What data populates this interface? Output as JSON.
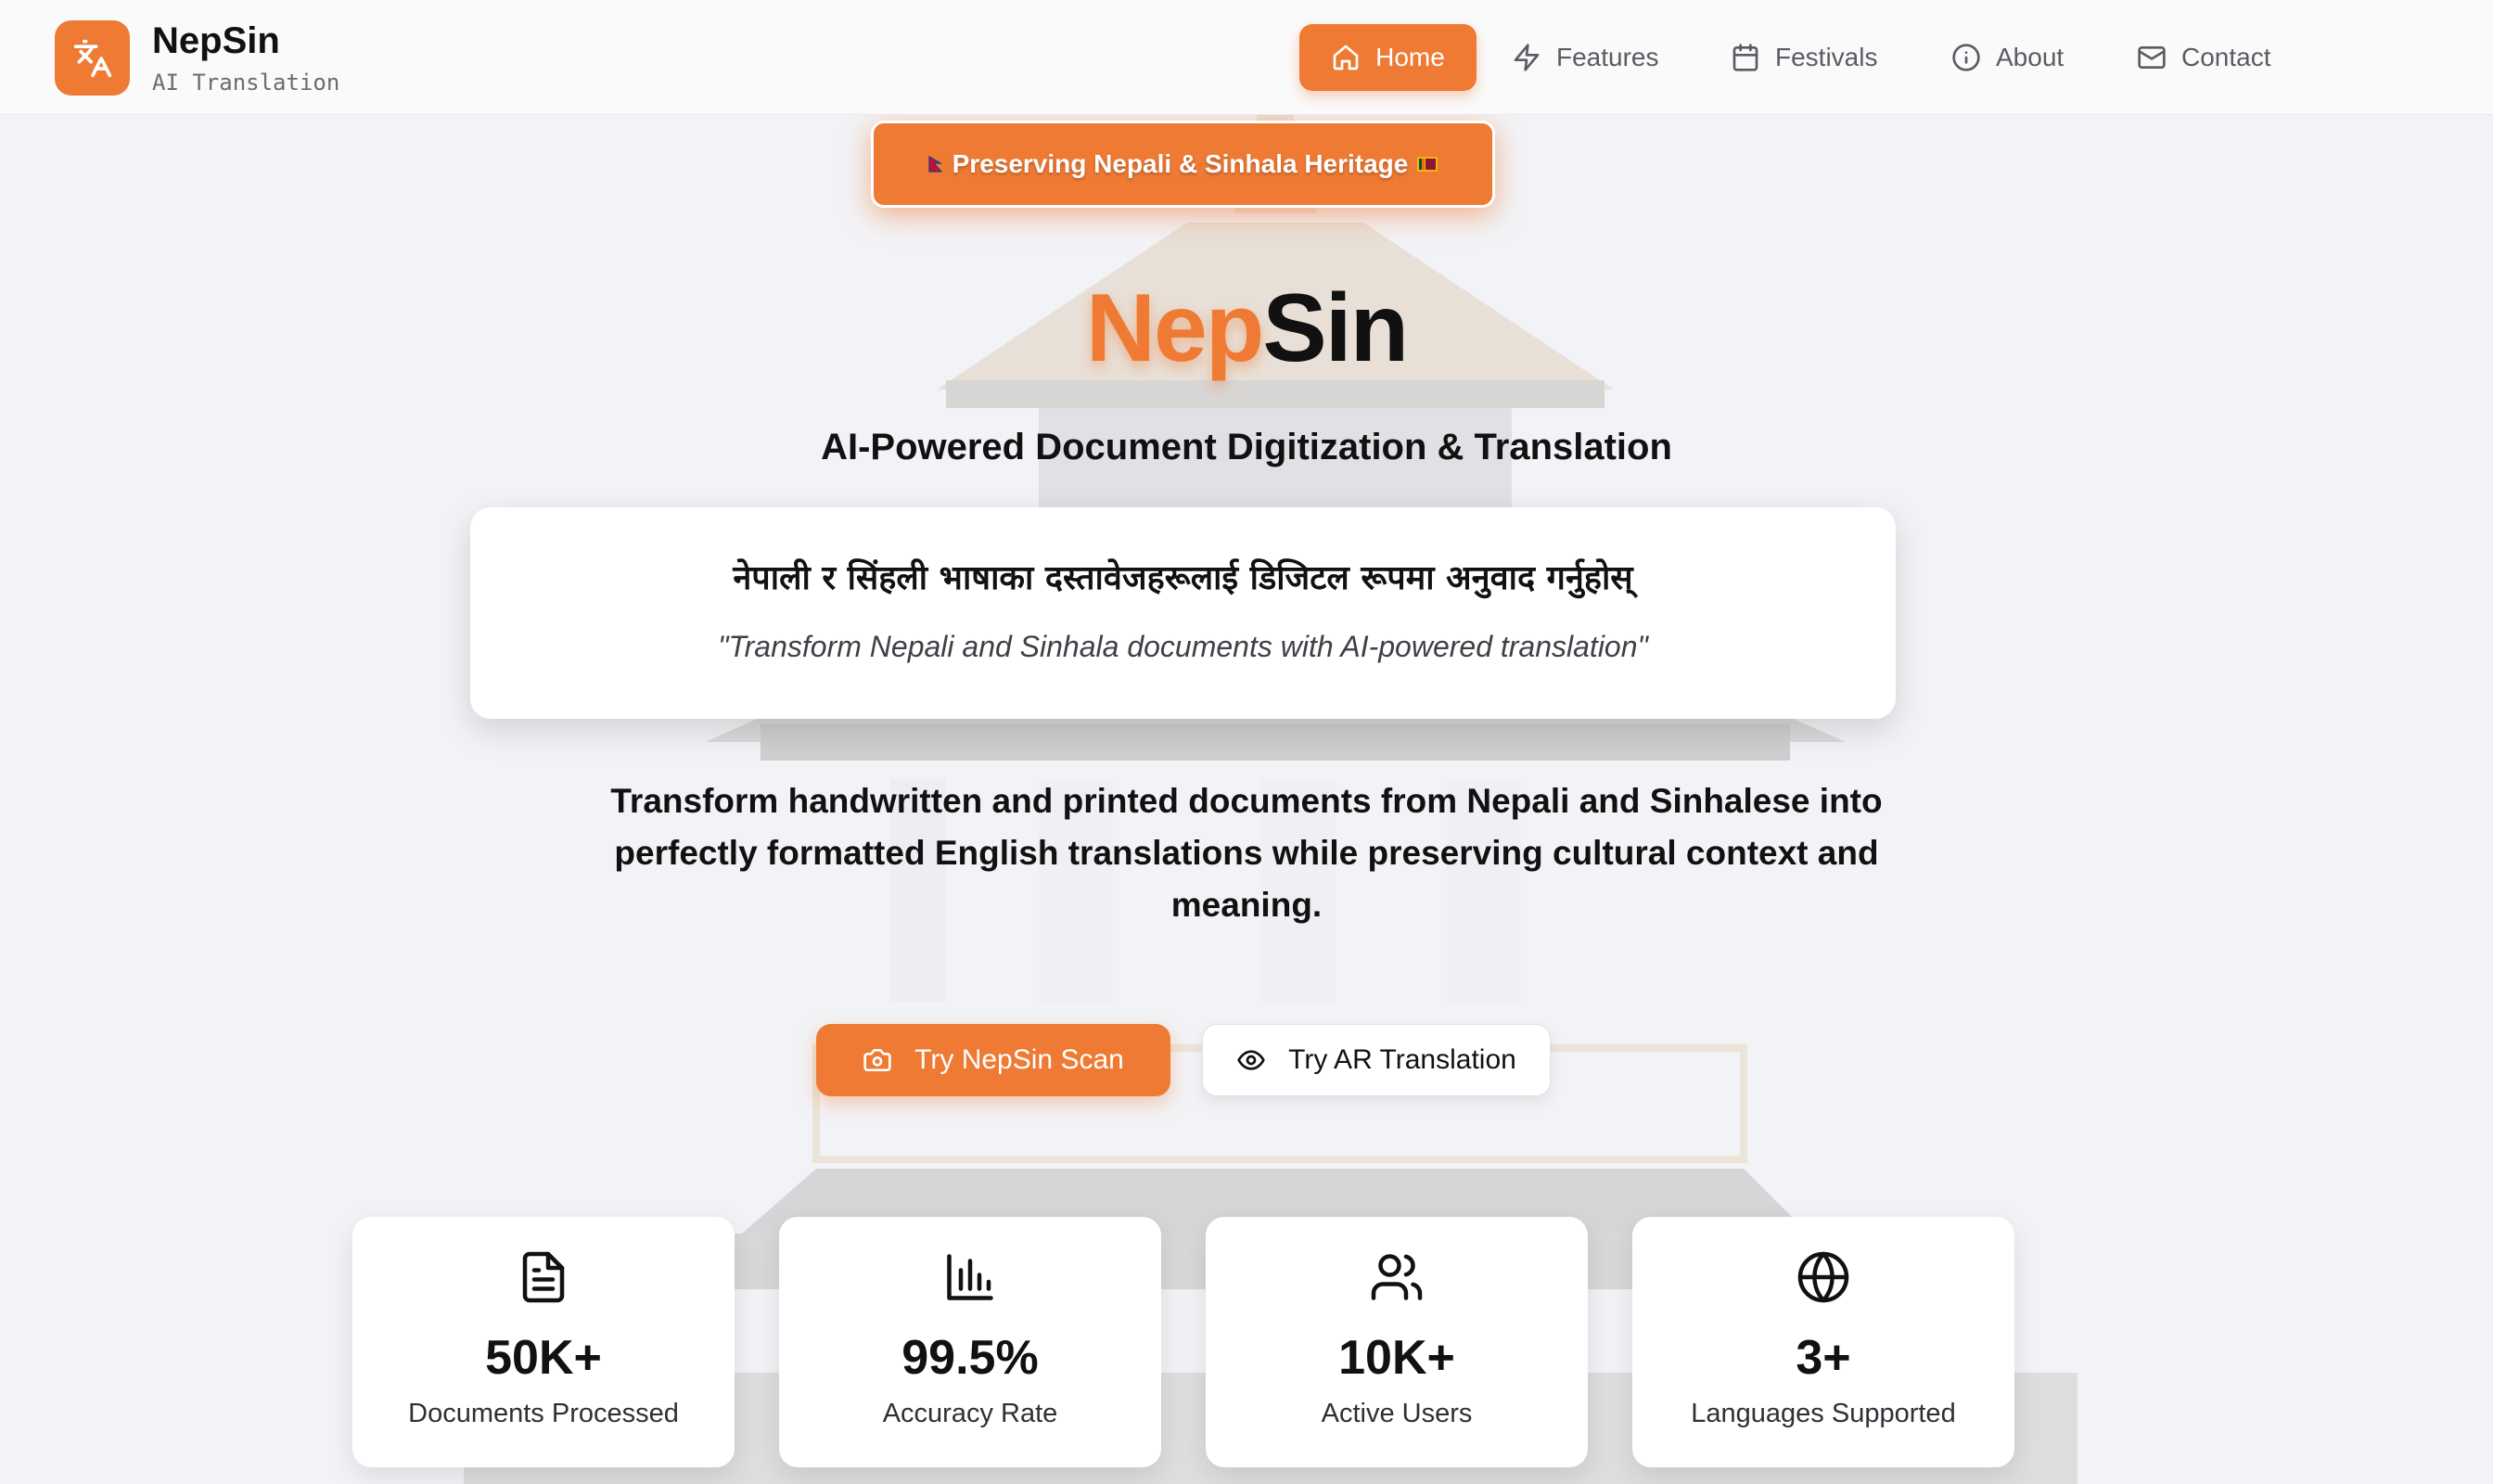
{
  "brand": {
    "name": "NepSin",
    "subtitle": "AI Translation",
    "accent_color": "#ee7a34",
    "logo_icon": "translate-icon"
  },
  "nav": {
    "items": [
      {
        "label": "Home",
        "icon": "home-icon",
        "active": true
      },
      {
        "label": "Features",
        "icon": "zap-icon",
        "active": false
      },
      {
        "label": "Festivals",
        "icon": "calendar-icon",
        "active": false
      },
      {
        "label": "About",
        "icon": "info-icon",
        "active": false
      },
      {
        "label": "Contact",
        "icon": "mail-icon",
        "active": false
      }
    ]
  },
  "hero": {
    "badge": "Preserving Nepali & Sinhala Heritage",
    "title_part1": "Nep",
    "title_part2": "Sin",
    "subtitle": "AI-Powered Document Digitization & Translation",
    "quote_native": "नेपाली र सिंहली भाषाका दस्तावेजहरूलाई डिजिटल रूपमा अनुवाद गर्नुहोस्",
    "quote_english": "\"Transform Nepali and Sinhala documents with AI-powered translation\"",
    "description": "Transform handwritten and printed documents from Nepali and Sinhalese into perfectly formatted English translations while preserving cultural context and meaning.",
    "primary_button": {
      "label": "Try NepSin Scan",
      "icon": "camera-icon"
    },
    "secondary_button": {
      "label": "Try AR Translation",
      "icon": "eye-icon"
    }
  },
  "stats": [
    {
      "value": "50K+",
      "label": "Documents Processed",
      "icon": "file-text-icon"
    },
    {
      "value": "99.5%",
      "label": "Accuracy Rate",
      "icon": "bar-chart-icon"
    },
    {
      "value": "10K+",
      "label": "Active Users",
      "icon": "users-icon"
    },
    {
      "value": "3+",
      "label": "Languages Supported",
      "icon": "globe-icon"
    }
  ]
}
